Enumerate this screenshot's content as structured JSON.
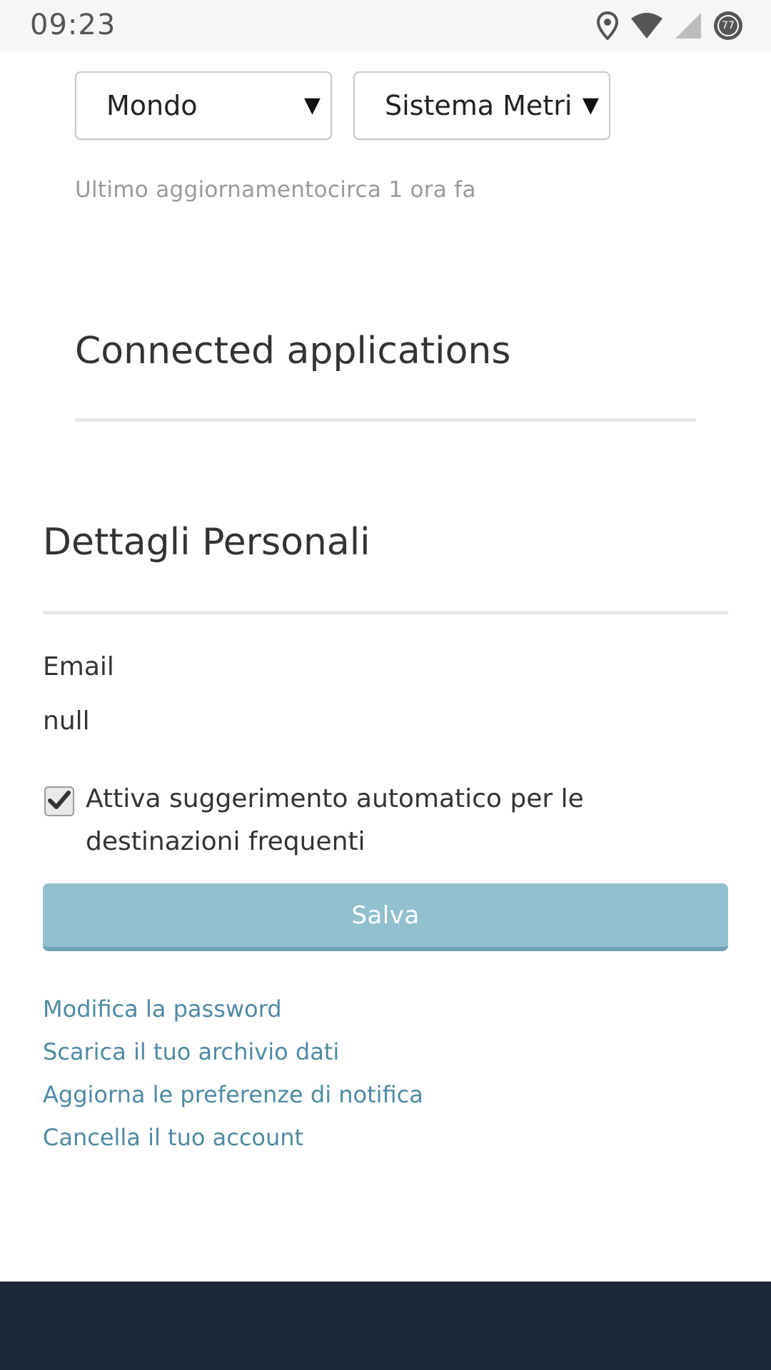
{
  "status_bar": {
    "time": "09:23",
    "battery_level": "77",
    "icons": [
      "location-icon",
      "wifi-icon",
      "cell-signal-icon",
      "battery-icon"
    ]
  },
  "settings": {
    "region_select": {
      "value": "Mondo"
    },
    "units_select": {
      "value": "Sistema Metri"
    },
    "last_update": "Ultimo aggiornamentocirca 1 ora fa"
  },
  "connected_apps": {
    "title": "Connected applications"
  },
  "personal_details": {
    "title": "Dettagli Personali",
    "email_label": "Email",
    "email_value": "null",
    "autosuggest_checkbox": {
      "checked": true,
      "label": "Attiva suggerimento automatico per le destinazioni frequenti"
    },
    "save_label": "Salva"
  },
  "account_links": [
    {
      "label": "Modifica la password"
    },
    {
      "label": "Scarica il tuo archivio dati"
    },
    {
      "label": "Aggiorna le preferenze di notifica"
    },
    {
      "label": "Cancella il tuo account"
    }
  ],
  "colors": {
    "save_button": "#92c0cf",
    "link": "#4f8aa3",
    "footer": "#1c2739"
  }
}
